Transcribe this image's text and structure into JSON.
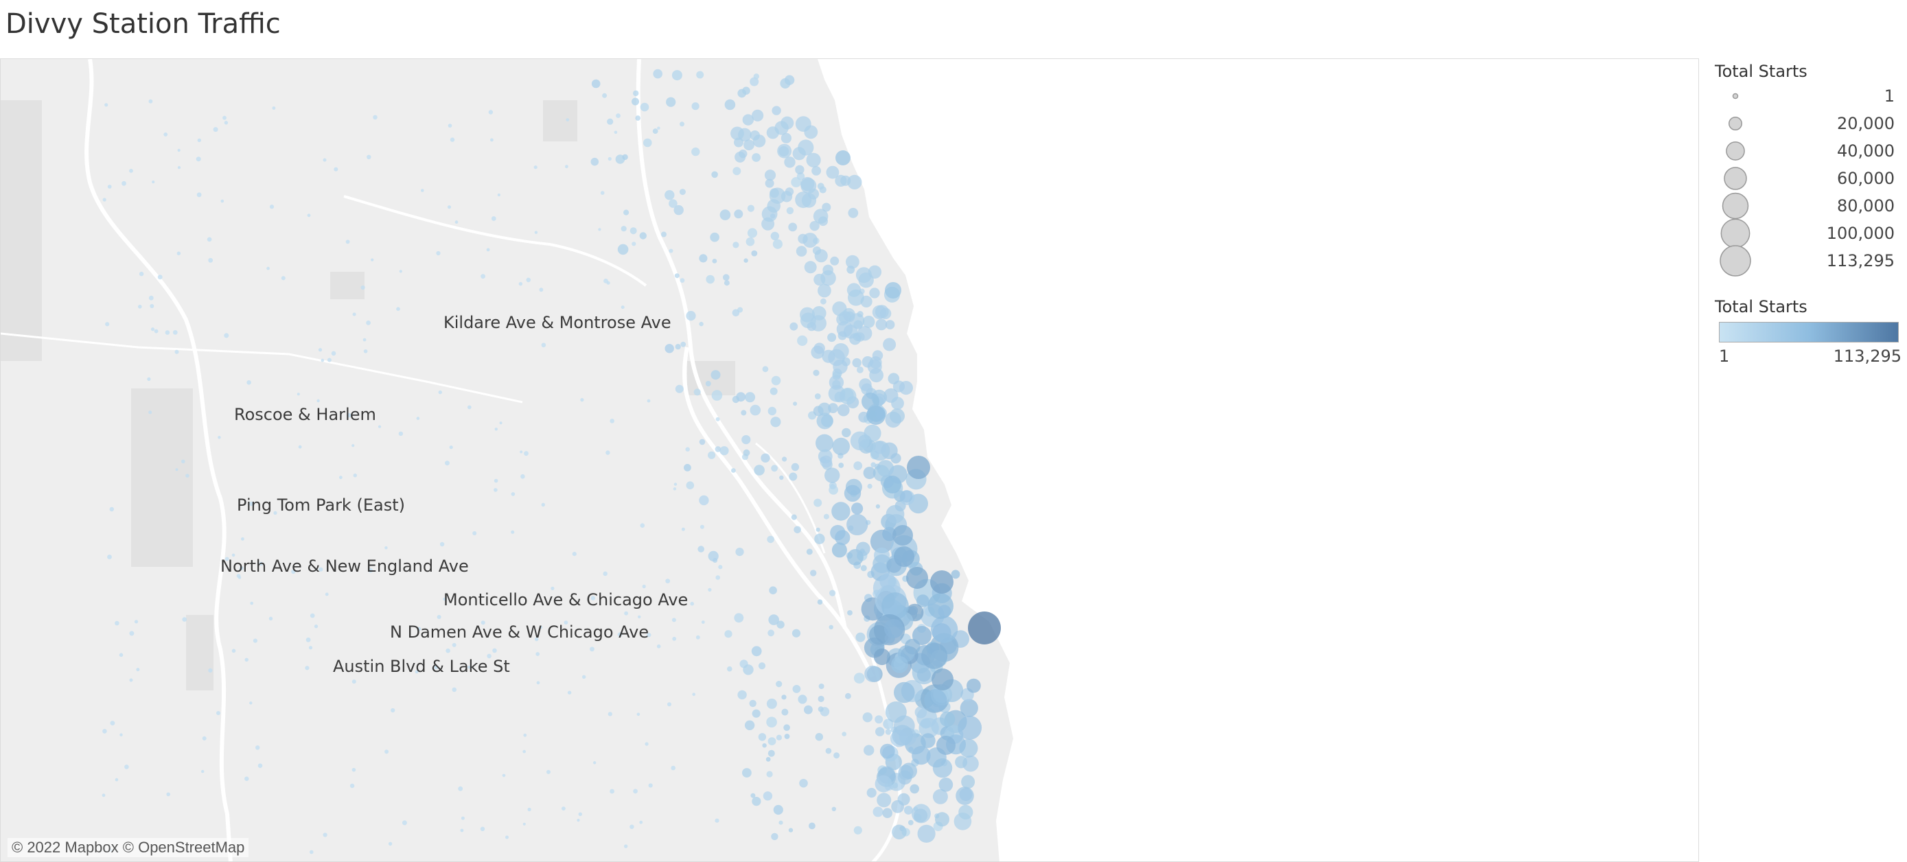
{
  "title": "Divvy Station Traffic",
  "attribution": "© 2022 Mapbox © OpenStreetMap",
  "colors": {
    "ramp_low": "#c9e3f3",
    "ramp_mid": "#8fbde0",
    "ramp_high": "#4e77a3",
    "land": "#eeeeee",
    "water": "#ffffff",
    "roads": "#ffffff"
  },
  "size_legend": {
    "title": "Total Starts",
    "entries": [
      {
        "label": "1",
        "value": 1
      },
      {
        "label": "20,000",
        "value": 20000
      },
      {
        "label": "40,000",
        "value": 40000
      },
      {
        "label": "60,000",
        "value": 60000
      },
      {
        "label": "80,000",
        "value": 80000
      },
      {
        "label": "100,000",
        "value": 100000
      },
      {
        "label": "113,295",
        "value": 113295
      }
    ]
  },
  "color_legend": {
    "title": "Total Starts",
    "min_label": "1",
    "max_label": "113,295"
  },
  "station_labels": [
    "Kildare Ave & Montrose Ave",
    "Roscoe & Harlem",
    "Ping Tom Park (East)",
    "North Ave & New England Ave",
    "Monticello Ave & Chicago Ave",
    "N Damen Ave & W Chicago Ave",
    "Austin Blvd & Lake St"
  ]
}
